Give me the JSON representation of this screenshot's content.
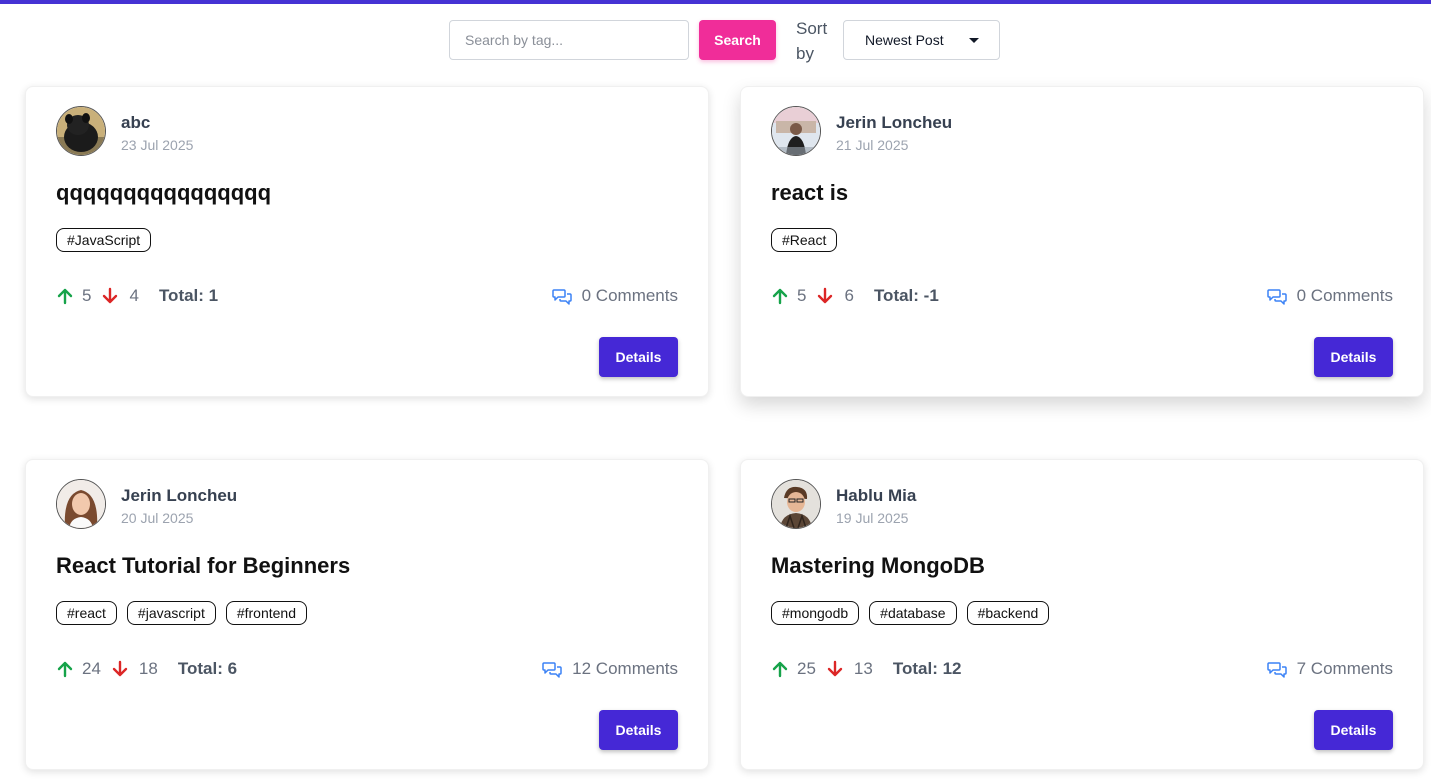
{
  "search": {
    "placeholder": "Search by tag...",
    "button_label": "Search"
  },
  "sort": {
    "label": "Sort by",
    "selected": "Newest Post"
  },
  "colors": {
    "accent": "#4528d6",
    "search_button": "#f02d99",
    "upvote": "#16a34a",
    "downvote": "#dc2626",
    "comment_icon": "#3b82f6"
  },
  "posts": [
    {
      "author": "abc",
      "date": "23 Jul 2025",
      "title": "qqqqqqqqqqqqqqqq",
      "tags": [
        "#JavaScript"
      ],
      "upvotes": "5",
      "downvotes": "4",
      "total": "Total: 1",
      "comments": "0 Comments",
      "details_label": "Details"
    },
    {
      "author": "Jerin Loncheu",
      "date": "21 Jul 2025",
      "title": "react is",
      "tags": [
        "#React"
      ],
      "upvotes": "5",
      "downvotes": "6",
      "total": "Total: -1",
      "comments": "0 Comments",
      "details_label": "Details"
    },
    {
      "author": "Jerin Loncheu",
      "date": "20 Jul 2025",
      "title": "React Tutorial for Beginners",
      "tags": [
        "#react",
        "#javascript",
        "#frontend"
      ],
      "upvotes": "24",
      "downvotes": "18",
      "total": "Total: 6",
      "comments": "12 Comments",
      "details_label": "Details"
    },
    {
      "author": "Hablu Mia",
      "date": "19 Jul 2025",
      "title": "Mastering MongoDB",
      "tags": [
        "#mongodb",
        "#database",
        "#backend"
      ],
      "upvotes": "25",
      "downvotes": "13",
      "total": "Total: 12",
      "comments": "7 Comments",
      "details_label": "Details"
    }
  ]
}
